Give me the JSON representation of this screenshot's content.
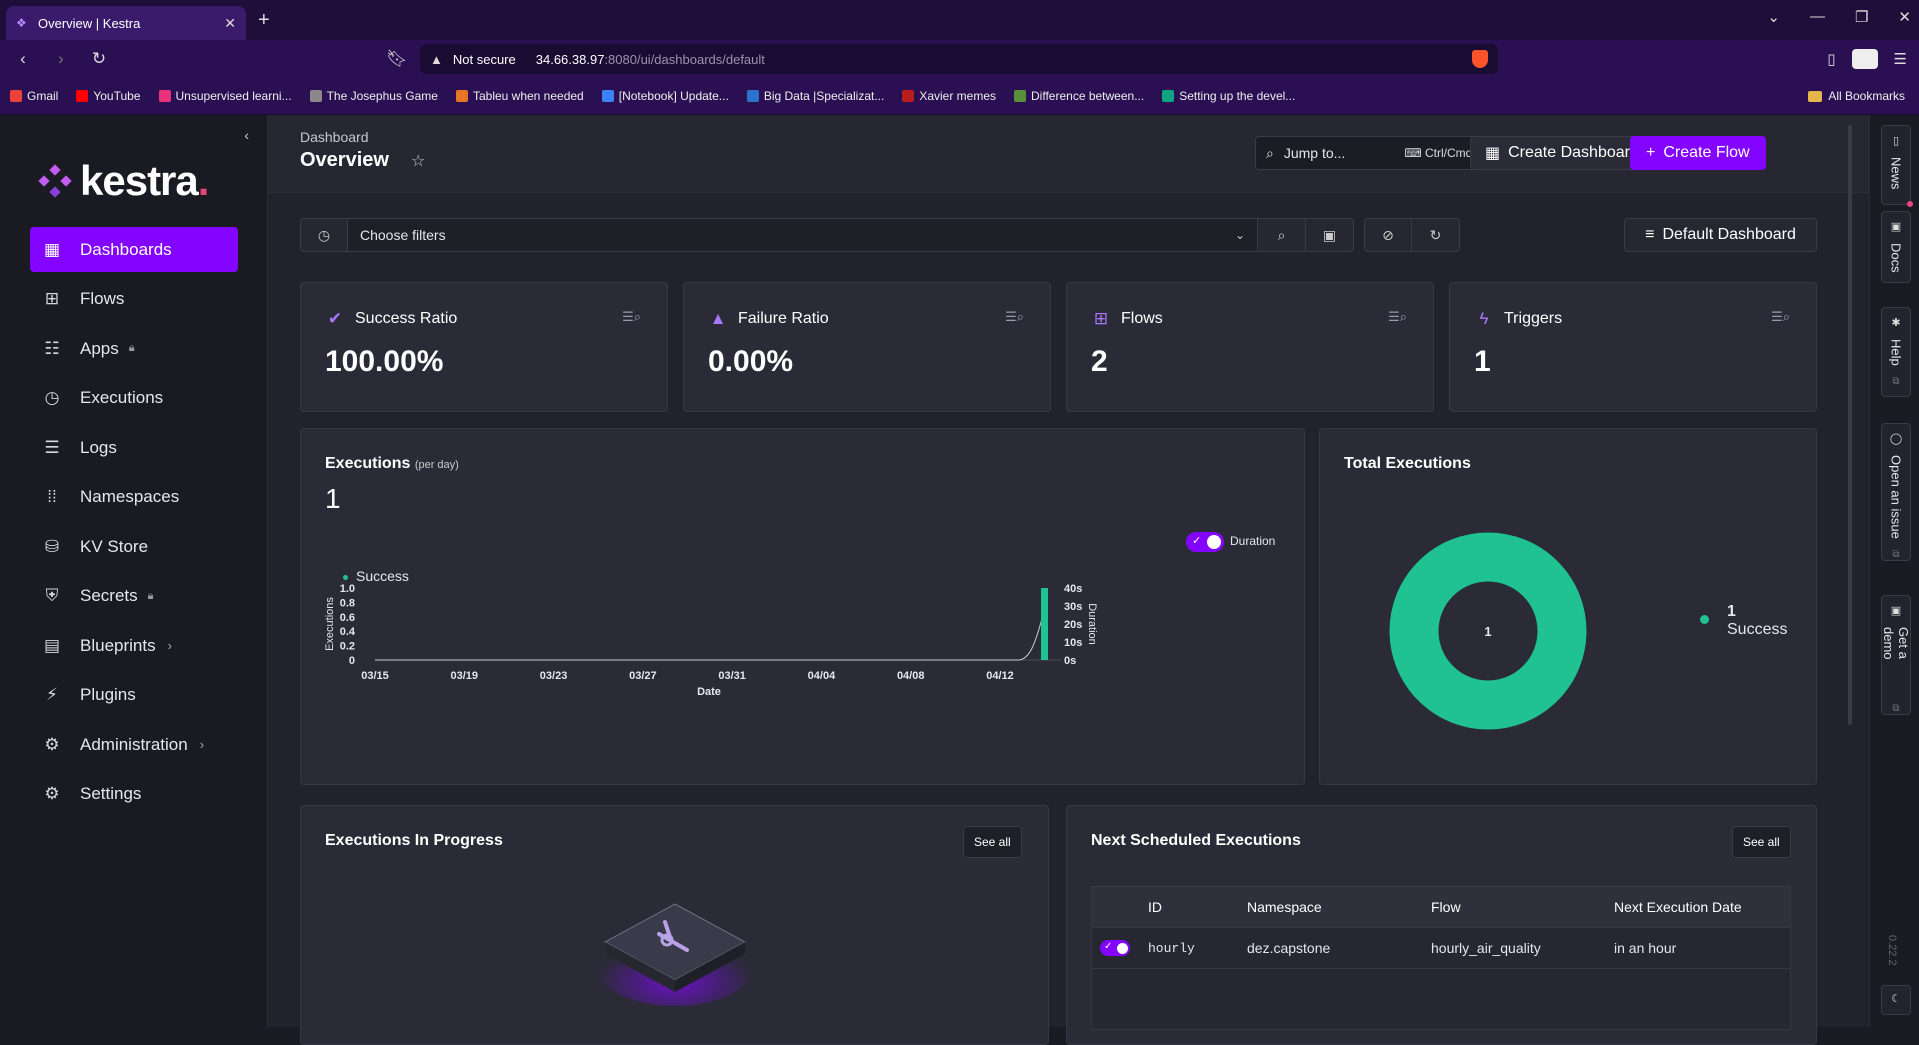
{
  "browser": {
    "tab_title": "Overview | Kestra",
    "security": "Not secure",
    "url_host": "34.66.38.97",
    "url_path": ":8080/ui/dashboards/default",
    "bookmarks": [
      {
        "label": "Gmail",
        "color": "#ea4335"
      },
      {
        "label": "YouTube",
        "color": "#ff0000"
      },
      {
        "label": "Unsupervised learni...",
        "color": "#e8317a"
      },
      {
        "label": "The Josephus Game",
        "color": "#888888"
      },
      {
        "label": "Tableu when needed",
        "color": "#e97627"
      },
      {
        "label": "[Notebook] Update...",
        "color": "#3b82f6"
      },
      {
        "label": "Big Data |Specializat...",
        "color": "#2a73cc"
      },
      {
        "label": "Xavier memes",
        "color": "#b91c1c"
      },
      {
        "label": "Difference between...",
        "color": "#5a8f3a"
      },
      {
        "label": "Setting up the devel...",
        "color": "#10a37f"
      }
    ],
    "all_bookmarks": "All Bookmarks"
  },
  "sidebar": {
    "brand": "kestra",
    "items": [
      {
        "label": "Dashboards",
        "icon": "dashboard-icon"
      },
      {
        "label": "Flows",
        "icon": "flows-icon"
      },
      {
        "label": "Apps",
        "icon": "apps-icon"
      },
      {
        "label": "Executions",
        "icon": "executions-icon"
      },
      {
        "label": "Logs",
        "icon": "logs-icon"
      },
      {
        "label": "Namespaces",
        "icon": "namespaces-icon"
      },
      {
        "label": "KV Store",
        "icon": "kv-store-icon"
      },
      {
        "label": "Secrets",
        "icon": "secrets-icon"
      },
      {
        "label": "Blueprints",
        "icon": "blueprints-icon"
      },
      {
        "label": "Plugins",
        "icon": "plugins-icon"
      },
      {
        "label": "Administration",
        "icon": "administration-icon"
      },
      {
        "label": "Settings",
        "icon": "settings-icon"
      }
    ]
  },
  "header": {
    "breadcrumb": "Dashboard",
    "title": "Overview",
    "jump_label": "Jump to...",
    "jump_shortcut": "Ctrl/Cmd + K",
    "create_dashboard": "Create Dashboard",
    "create_flow": "Create Flow"
  },
  "filters": {
    "placeholder": "Choose filters",
    "default_dashboard": "Default Dashboard"
  },
  "stats": [
    {
      "label": "Success Ratio",
      "value": "100.00%"
    },
    {
      "label": "Failure Ratio",
      "value": "0.00%"
    },
    {
      "label": "Flows",
      "value": "2"
    },
    {
      "label": "Triggers",
      "value": "1"
    }
  ],
  "executions_panel": {
    "title": "Executions",
    "subtitle": "(per day)",
    "count": "1",
    "toggle_label": "Duration",
    "legend": "Success"
  },
  "chart_data": [
    {
      "type": "bar",
      "title": "Executions",
      "xlabel": "Date",
      "ylabel": "Executions",
      "y2label": "Duration",
      "categories": [
        "03/15",
        "03/19",
        "03/23",
        "03/27",
        "03/31",
        "04/04",
        "04/08",
        "04/12"
      ],
      "ylim": [
        0,
        1.0
      ],
      "yticks": [
        "1.0",
        "0.8",
        "0.6",
        "0.4",
        "0.2",
        "0"
      ],
      "y2ticks": [
        "40s",
        "30s",
        "20s",
        "10s",
        "0s"
      ],
      "series": [
        {
          "name": "Success",
          "points": [
            {
              "x": "04/14",
              "y": 1
            }
          ],
          "color": "#1fc290"
        }
      ],
      "duration_line": {
        "color": "#cccccc",
        "last_value_s": 35
      }
    },
    {
      "type": "pie",
      "title": "Total Executions",
      "center_label": "1",
      "slices": [
        {
          "name": "Success",
          "value": 1,
          "color": "#1fc290"
        }
      ]
    }
  ],
  "total_panel": {
    "title": "Total Executions",
    "legend_count": "1",
    "legend_label": "Success"
  },
  "in_progress": {
    "title": "Executions In Progress",
    "see_all": "See all"
  },
  "scheduled": {
    "title": "Next Scheduled Executions",
    "see_all": "See all",
    "columns": [
      "ID",
      "Namespace",
      "Flow",
      "Next Execution Date"
    ],
    "rows": [
      {
        "id": "hourly",
        "namespace": "dez.capstone",
        "flow": "hourly_air_quality",
        "next": "in an hour"
      }
    ]
  },
  "rightbar": {
    "tabs": [
      "News",
      "Docs",
      "Help",
      "Open an issue",
      "Get a demo"
    ],
    "version": "0.22.2"
  },
  "colors": {
    "accent": "#8405ff",
    "success": "#1fc290"
  }
}
